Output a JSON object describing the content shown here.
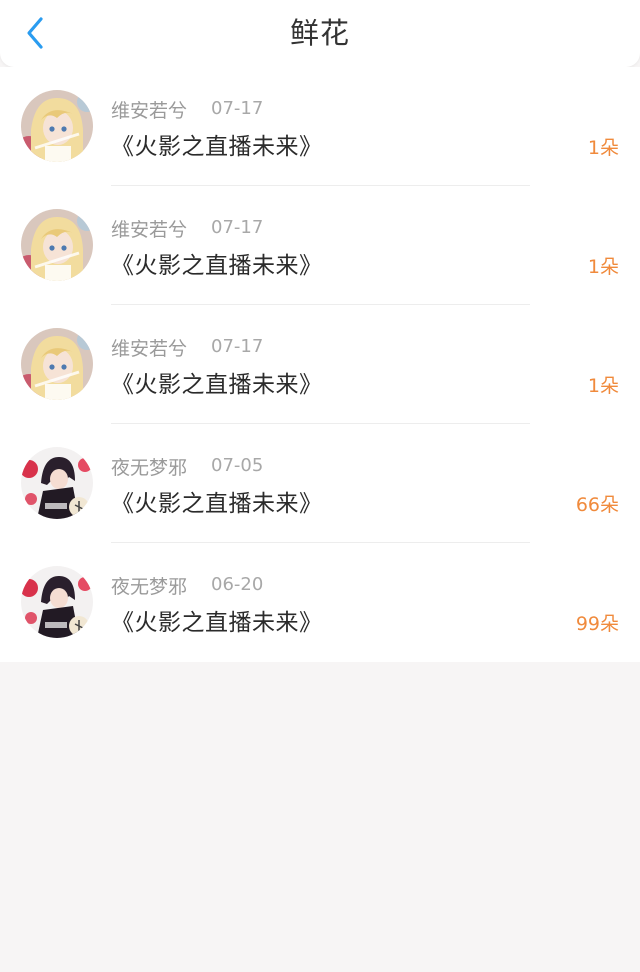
{
  "header": {
    "title": "鲜花",
    "back_icon": "chevron-left-icon",
    "accent_color": "#2a9cf0"
  },
  "items": [
    {
      "name": "维安若兮",
      "date": "07-17",
      "book": "《火影之直播未来》",
      "amount": "1朵",
      "avatar": "anime-blonde-girl-avatar"
    },
    {
      "name": "维安若兮",
      "date": "07-17",
      "book": "《火影之直播未来》",
      "amount": "1朵",
      "avatar": "anime-blonde-girl-avatar"
    },
    {
      "name": "维安若兮",
      "date": "07-17",
      "book": "《火影之直播未来》",
      "amount": "1朵",
      "avatar": "anime-blonde-girl-avatar"
    },
    {
      "name": "夜无梦邪",
      "date": "07-05",
      "book": "《火影之直播未来》",
      "amount": "66朵",
      "avatar": "anime-dark-hair-avatar"
    },
    {
      "name": "夜无梦邪",
      "date": "06-20",
      "book": "《火影之直播未来》",
      "amount": "99朵",
      "avatar": "anime-dark-hair-avatar"
    }
  ],
  "colors": {
    "amount": "#f08a3c",
    "meta": "#9a9a9a",
    "background": "#f7f5f5"
  }
}
